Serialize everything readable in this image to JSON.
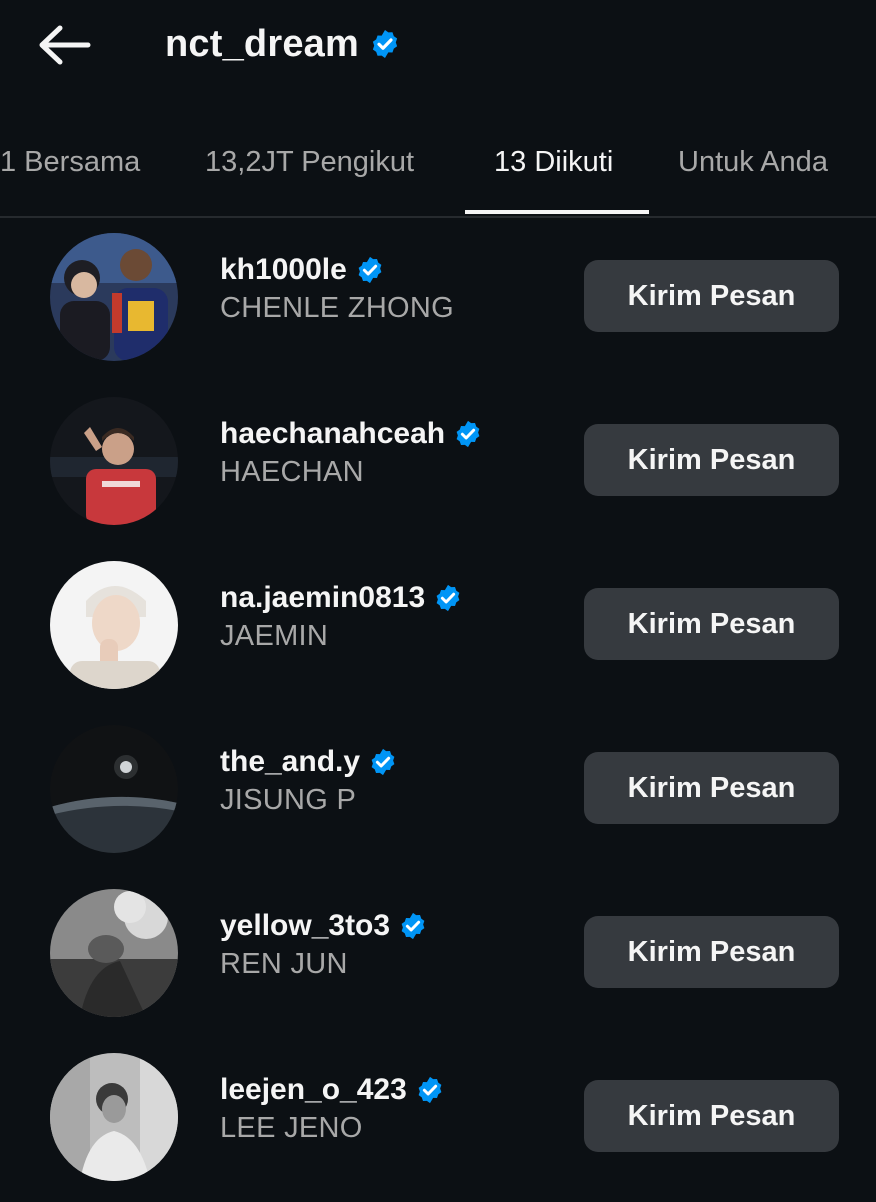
{
  "header": {
    "title": "nct_dream"
  },
  "tabs": [
    {
      "label": "1 Bersama",
      "active": false
    },
    {
      "label": "13,2JT Pengikut",
      "active": false
    },
    {
      "label": "13 Diikuti",
      "active": true
    },
    {
      "label": "Untuk Anda",
      "active": false
    }
  ],
  "following": [
    {
      "username": "kh1000le",
      "name": "CHENLE ZHONG",
      "button": "Kirim Pesan"
    },
    {
      "username": "haechanahceah",
      "name": "HAECHAN",
      "button": "Kirim Pesan"
    },
    {
      "username": "na.jaemin0813",
      "name": "JAEMIN",
      "button": "Kirim Pesan"
    },
    {
      "username": "the_and.y",
      "name": "JISUNG P",
      "button": "Kirim Pesan"
    },
    {
      "username": "yellow_3to3",
      "name": "REN JUN",
      "button": "Kirim Pesan"
    },
    {
      "username": "leejen_o_423",
      "name": "LEE JENO",
      "button": "Kirim Pesan"
    }
  ],
  "colors": {
    "background": "#0c1014",
    "verified": "#0095f6",
    "button": "#363a3f",
    "muted_text": "#a8a8a8"
  },
  "icons": {
    "back": "arrow-left-icon",
    "verified": "verified-badge-icon"
  }
}
